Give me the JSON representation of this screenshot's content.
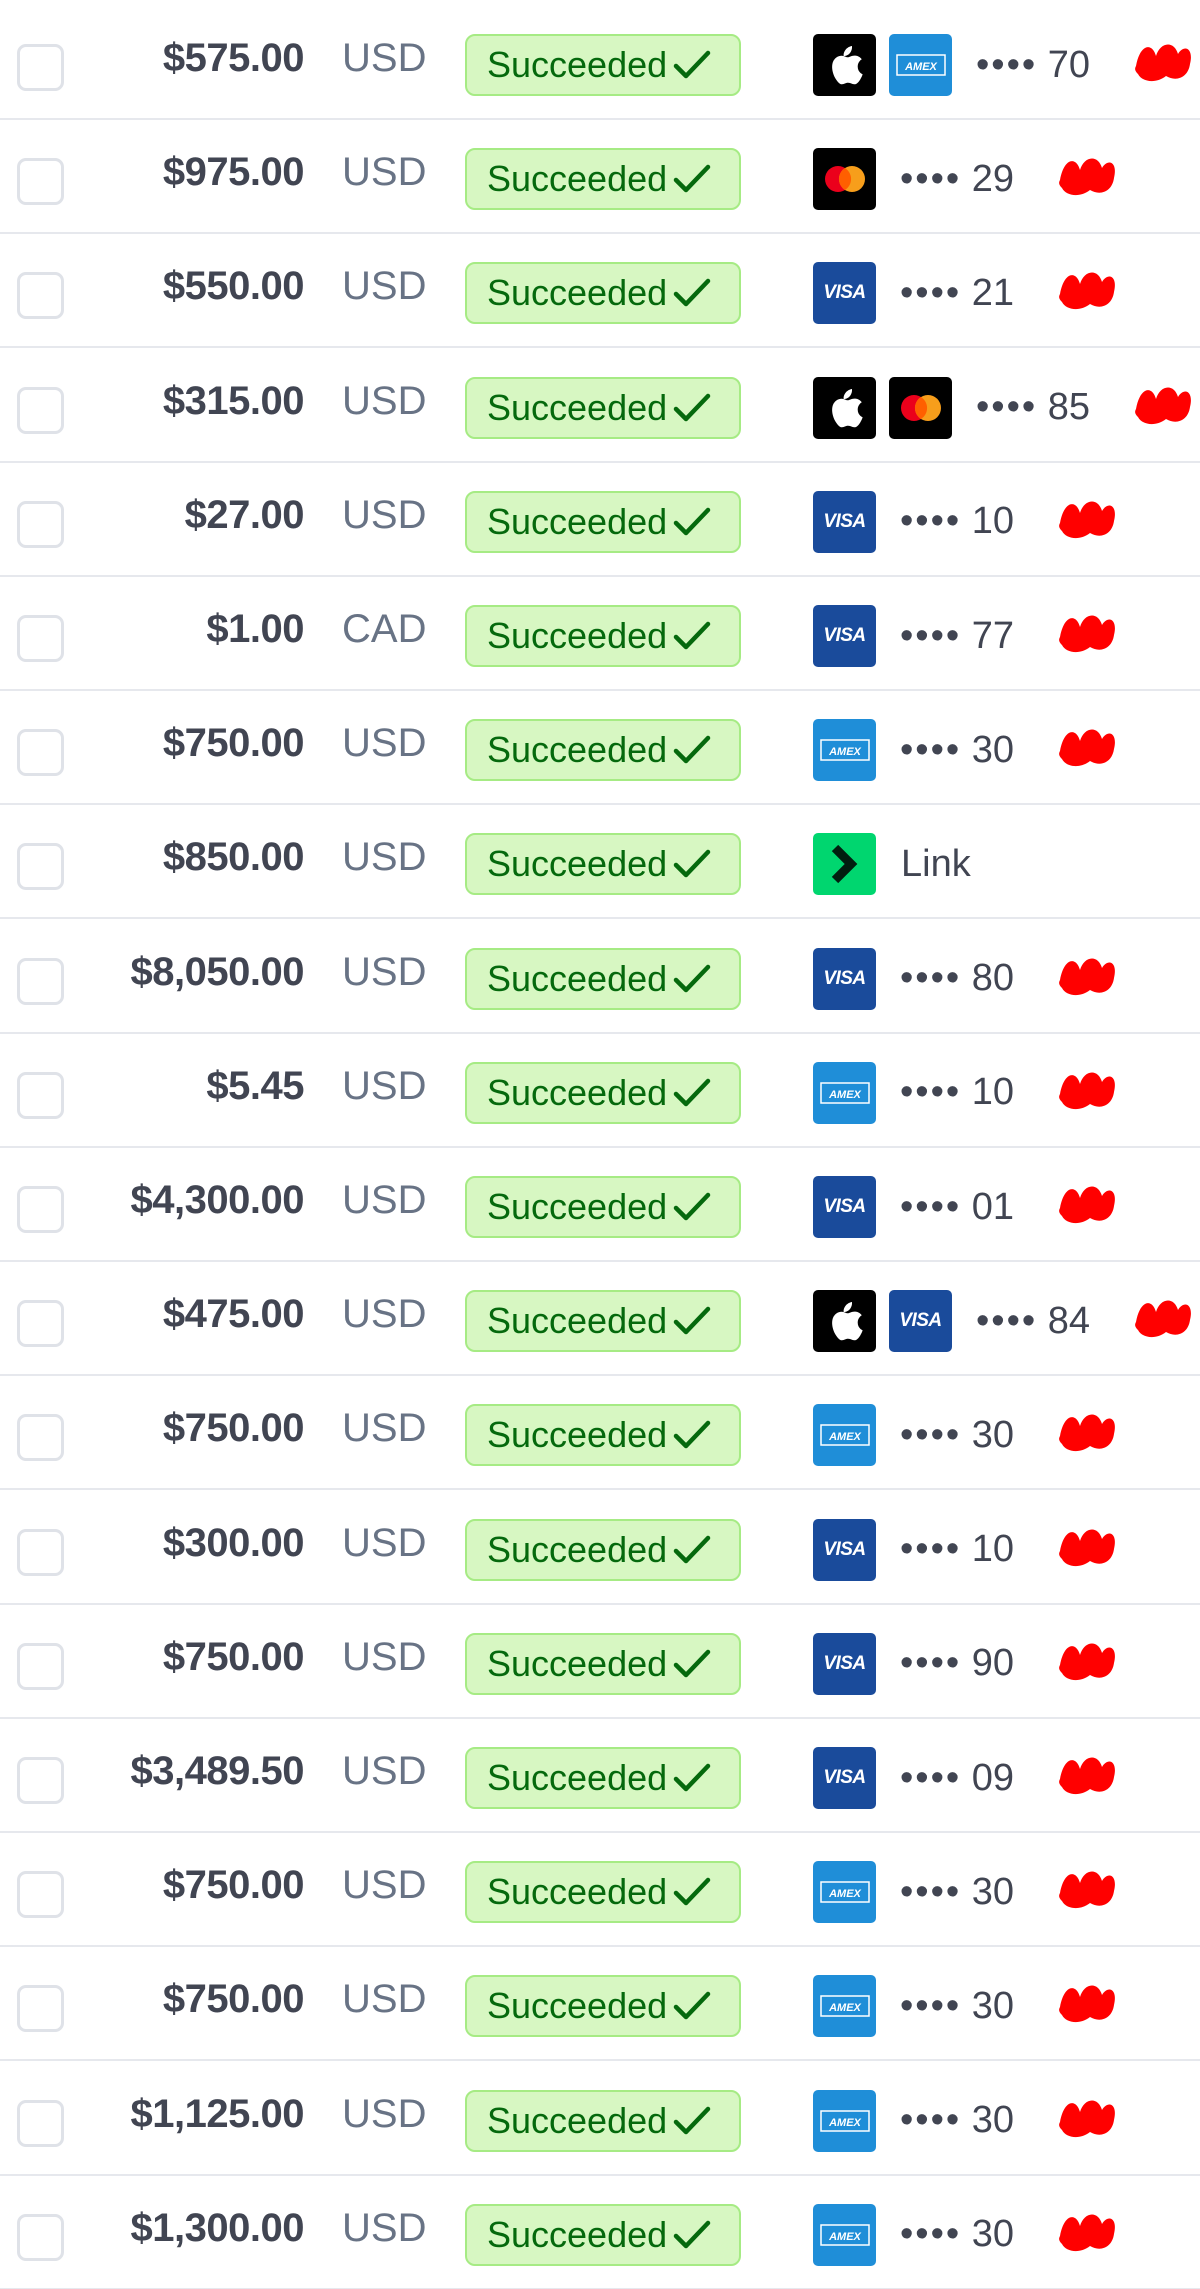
{
  "status_label": "Succeeded",
  "mask_dots": "••••",
  "colors": {
    "badge_bg": "#d7f7c2",
    "badge_border": "#a6eb84",
    "badge_text": "#05690d",
    "amount_text": "#414552",
    "currency_text": "#687385",
    "redaction": "#ff0000"
  },
  "payments": [
    {
      "amount": "$575.00",
      "currency": "USD",
      "methods": [
        "apple-pay",
        "amex"
      ],
      "last4": "70"
    },
    {
      "amount": "$975.00",
      "currency": "USD",
      "methods": [
        "mastercard"
      ],
      "last4": "29"
    },
    {
      "amount": "$550.00",
      "currency": "USD",
      "methods": [
        "visa"
      ],
      "last4": "21"
    },
    {
      "amount": "$315.00",
      "currency": "USD",
      "methods": [
        "apple-pay",
        "mastercard"
      ],
      "last4": "85"
    },
    {
      "amount": "$27.00",
      "currency": "USD",
      "methods": [
        "visa"
      ],
      "last4": "10"
    },
    {
      "amount": "$1.00",
      "currency": "CAD",
      "methods": [
        "visa"
      ],
      "last4": "77"
    },
    {
      "amount": "$750.00",
      "currency": "USD",
      "methods": [
        "amex"
      ],
      "last4": "30"
    },
    {
      "amount": "$850.00",
      "currency": "USD",
      "methods": [
        "link"
      ],
      "link_label": "Link"
    },
    {
      "amount": "$8,050.00",
      "currency": "USD",
      "methods": [
        "visa"
      ],
      "last4": "80"
    },
    {
      "amount": "$5.45",
      "currency": "USD",
      "methods": [
        "amex"
      ],
      "last4": "10"
    },
    {
      "amount": "$4,300.00",
      "currency": "USD",
      "methods": [
        "visa"
      ],
      "last4": "01"
    },
    {
      "amount": "$475.00",
      "currency": "USD",
      "methods": [
        "apple-pay",
        "visa"
      ],
      "last4": "84"
    },
    {
      "amount": "$750.00",
      "currency": "USD",
      "methods": [
        "amex"
      ],
      "last4": "30"
    },
    {
      "amount": "$300.00",
      "currency": "USD",
      "methods": [
        "visa"
      ],
      "last4": "10"
    },
    {
      "amount": "$750.00",
      "currency": "USD",
      "methods": [
        "visa"
      ],
      "last4": "90"
    },
    {
      "amount": "$3,489.50",
      "currency": "USD",
      "methods": [
        "visa"
      ],
      "last4": "09"
    },
    {
      "amount": "$750.00",
      "currency": "USD",
      "methods": [
        "amex"
      ],
      "last4": "30"
    },
    {
      "amount": "$750.00",
      "currency": "USD",
      "methods": [
        "amex"
      ],
      "last4": "30"
    },
    {
      "amount": "$1,125.00",
      "currency": "USD",
      "methods": [
        "amex"
      ],
      "last4": "30"
    },
    {
      "amount": "$1,300.00",
      "currency": "USD",
      "methods": [
        "amex"
      ],
      "last4": "30"
    }
  ]
}
